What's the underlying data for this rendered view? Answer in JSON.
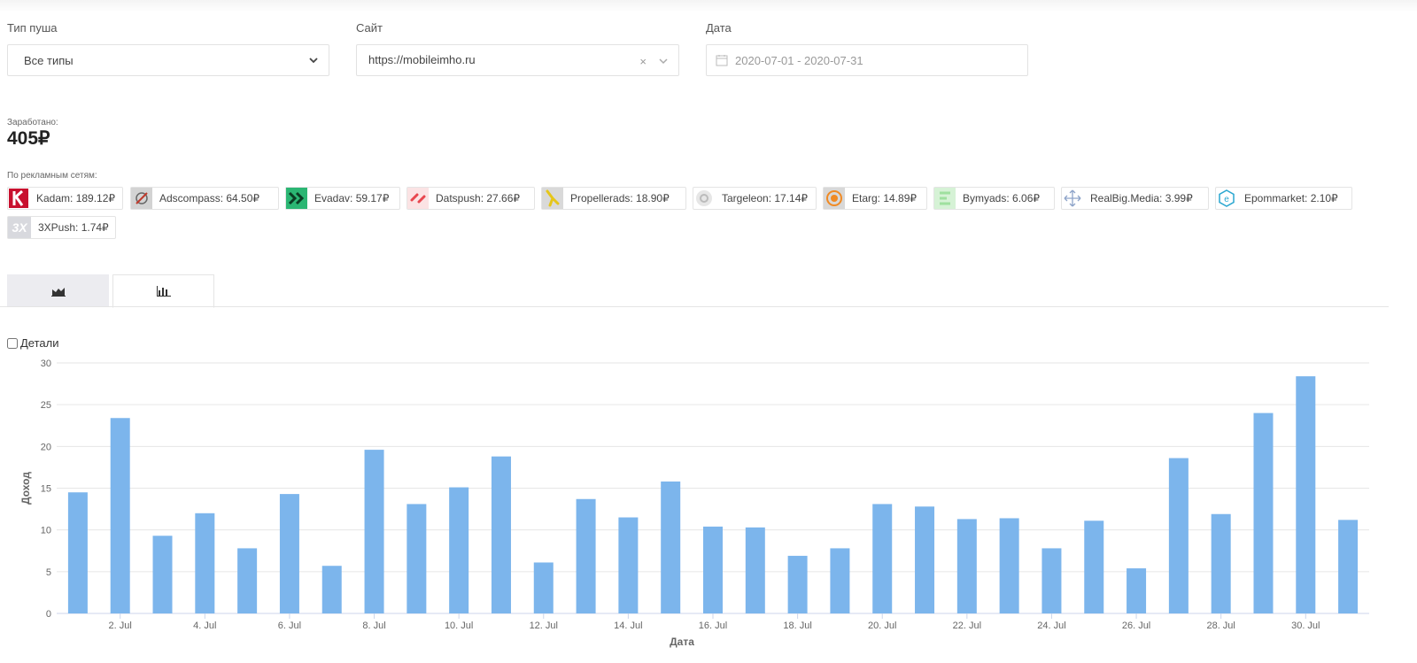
{
  "filters": {
    "push_type": {
      "label": "Тип пуша",
      "value": "Все типы"
    },
    "site": {
      "label": "Сайт",
      "value": "https://mobileimho.ru",
      "clear": "×"
    },
    "date": {
      "label": "Дата",
      "value": "2020-07-01 - 2020-07-31"
    }
  },
  "earnings": {
    "label": "Заработано:",
    "value": "405₽"
  },
  "networks": {
    "label": "По рекламным сетям:",
    "items": [
      {
        "name": "Kadam",
        "text": "Kadam: 189.12₽",
        "color": "#c8102e"
      },
      {
        "name": "Adscompass",
        "text": "Adscompass: 64.50₽",
        "color": "#8a8a8a"
      },
      {
        "name": "Evadav",
        "text": "Evadav: 59.17₽",
        "color": "#2bb673"
      },
      {
        "name": "Datspush",
        "text": "Datspush: 27.66₽",
        "color": "#e8474f"
      },
      {
        "name": "Propellerads",
        "text": "Propellerads: 18.90₽",
        "color": "#e6c619"
      },
      {
        "name": "Targeleon",
        "text": "Targeleon: 17.14₽",
        "color": "#cfcfcf"
      },
      {
        "name": "Etarg",
        "text": "Etarg: 14.89₽",
        "color": "#f08a24"
      },
      {
        "name": "Bymyads",
        "text": "Bymyads: 6.06₽",
        "color": "#9fe09f"
      },
      {
        "name": "RealBig.Media",
        "text": "RealBig.Media: 3.99₽",
        "color": "#8da3c9"
      },
      {
        "name": "Epommarket",
        "text": "Epommarket: 2.10₽",
        "color": "#2aa7d0"
      },
      {
        "name": "3XPush",
        "text": "3XPush: 1.74₽",
        "color": "#c9c9cf",
        "logo_text": "3X"
      }
    ]
  },
  "tabs": [
    {
      "name": "area-chart-tab",
      "icon": "area-chart-icon",
      "active": false
    },
    {
      "name": "bar-chart-tab",
      "icon": "bar-chart-icon",
      "active": true
    }
  ],
  "details": {
    "label": "Детали",
    "checked": false
  },
  "chart_data": {
    "type": "bar",
    "title": "",
    "xlabel": "Дата",
    "ylabel": "Доход",
    "ylim": [
      0,
      30
    ],
    "yticks": [
      0,
      5,
      10,
      15,
      20,
      25,
      30
    ],
    "grid": true,
    "bar_color": "#7cb5ec",
    "x_tick_labels": [
      "2. Jul",
      "4. Jul",
      "6. Jul",
      "8. Jul",
      "10. Jul",
      "12. Jul",
      "14. Jul",
      "16. Jul",
      "18. Jul",
      "20. Jul",
      "22. Jul",
      "24. Jul",
      "26. Jul",
      "28. Jul",
      "30. Jul"
    ],
    "x_tick_days": [
      2,
      4,
      6,
      8,
      10,
      12,
      14,
      16,
      18,
      20,
      22,
      24,
      26,
      28,
      30
    ],
    "categories": [
      "2020-07-01",
      "2020-07-02",
      "2020-07-03",
      "2020-07-04",
      "2020-07-05",
      "2020-07-06",
      "2020-07-07",
      "2020-07-08",
      "2020-07-09",
      "2020-07-10",
      "2020-07-11",
      "2020-07-12",
      "2020-07-13",
      "2020-07-14",
      "2020-07-15",
      "2020-07-16",
      "2020-07-17",
      "2020-07-18",
      "2020-07-19",
      "2020-07-20",
      "2020-07-21",
      "2020-07-22",
      "2020-07-23",
      "2020-07-24",
      "2020-07-25",
      "2020-07-26",
      "2020-07-27",
      "2020-07-28",
      "2020-07-29",
      "2020-07-30",
      "2020-07-31"
    ],
    "values": [
      14.5,
      23.4,
      9.3,
      12.0,
      7.8,
      14.3,
      5.7,
      19.6,
      13.1,
      15.1,
      18.8,
      6.1,
      13.7,
      11.5,
      15.8,
      10.4,
      10.3,
      6.9,
      7.8,
      13.1,
      12.8,
      11.3,
      11.4,
      7.8,
      11.1,
      5.4,
      18.6,
      11.9,
      24.0,
      28.4,
      11.2
    ]
  }
}
